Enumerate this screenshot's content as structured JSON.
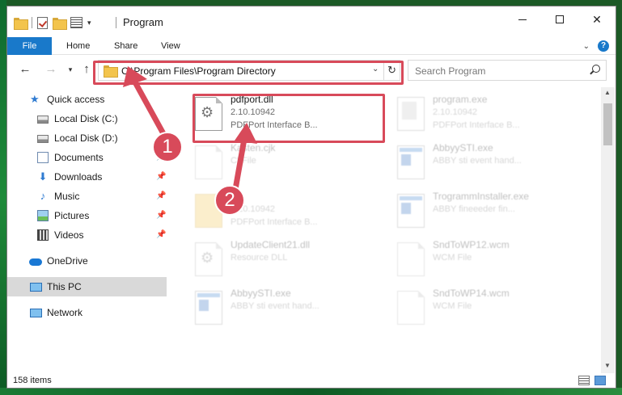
{
  "window": {
    "title": "Program",
    "buttons": {
      "minimize": "minimize",
      "maximize": "maximize",
      "close": "✕"
    }
  },
  "ribbon": {
    "tabs": [
      {
        "label": "File"
      },
      {
        "label": "Home"
      },
      {
        "label": "Share"
      },
      {
        "label": "View"
      }
    ],
    "help": "?"
  },
  "nav": {
    "address": "C:\\Program Files\\Program Directory",
    "search_placeholder": "Search Program"
  },
  "sidebar": {
    "items": [
      {
        "label": "Quick access",
        "icon": "star-icon"
      },
      {
        "label": "Local Disk (C:)",
        "icon": "drive-icon"
      },
      {
        "label": "Local Disk (D:)",
        "icon": "drive-icon"
      },
      {
        "label": "Documents",
        "icon": "documents-icon",
        "pinned": true
      },
      {
        "label": "Downloads",
        "icon": "downloads-icon",
        "pinned": true
      },
      {
        "label": "Music",
        "icon": "music-icon",
        "pinned": true
      },
      {
        "label": "Pictures",
        "icon": "pictures-icon",
        "pinned": true
      },
      {
        "label": "Videos",
        "icon": "videos-icon",
        "pinned": true
      },
      {
        "label": "OneDrive",
        "icon": "onedrive-icon"
      },
      {
        "label": "This PC",
        "icon": "this-pc-icon",
        "selected": true
      },
      {
        "label": "Network",
        "icon": "network-icon"
      }
    ]
  },
  "files": [
    {
      "name": "pdfport.dll",
      "line2": "2.10.10942",
      "line3": "PDFPort Interface B...",
      "icon": "dll-icon",
      "highlighted": true
    },
    {
      "name": "program.exe",
      "line2": "2.10.10942",
      "line3": "PDFPort Interface B...",
      "icon": "exe-icon"
    },
    {
      "name": "Kasten.cjk",
      "line2": "Cf File",
      "line3": "",
      "icon": "file-icon"
    },
    {
      "name": "AbbyySTI.exe",
      "line2": "ABBY sti event hand...",
      "line3": "",
      "icon": "exe-icon"
    },
    {
      "name": "",
      "line2": "2.10.10942",
      "line3": "PDFPort Interface B...",
      "icon": "folder-icon"
    },
    {
      "name": "TrogrammInstaller.exe",
      "line2": "ABBY fineeeder fin...",
      "line3": "",
      "icon": "exe-icon"
    },
    {
      "name": "UpdateClient21.dll",
      "line2": "Resource DLL",
      "line3": "",
      "icon": "dll-icon"
    },
    {
      "name": "SndToWP12.wcm",
      "line2": "WCM File",
      "line3": "",
      "icon": "file-icon"
    },
    {
      "name": "AbbyySTI.exe",
      "line2": "ABBY sti event hand...",
      "line3": "",
      "icon": "exe-icon"
    },
    {
      "name": "SndToWP14.wcm",
      "line2": "WCM File",
      "line3": "",
      "icon": "file-icon"
    }
  ],
  "status": {
    "count_text": "158 items"
  },
  "annotations": [
    {
      "number": "1"
    },
    {
      "number": "2"
    }
  ],
  "colors": {
    "accent": "#1979ca",
    "annotation": "#d84a5a"
  }
}
